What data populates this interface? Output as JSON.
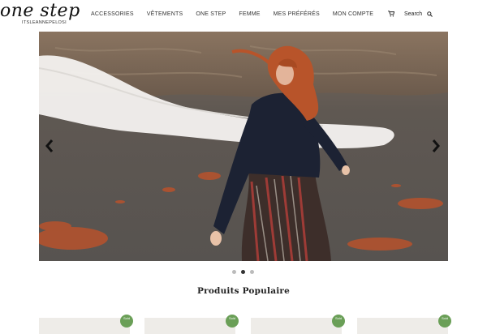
{
  "header": {
    "logo": "one step",
    "logo_sub": "ITSLEANNEPELOSI",
    "nav": [
      "ACCESSORIES",
      "VÊTEMENTS",
      "ONE STEP",
      "FEMME",
      "MES PRÉFÉRÉS",
      "MON COMPTE"
    ],
    "search_label": "Search"
  },
  "slider": {
    "prev_icon": "chevron-left-icon",
    "next_icon": "chevron-right-icon",
    "slide_count": 3,
    "active_slide": 2
  },
  "section": {
    "title": "Produits Populaire"
  },
  "products": [
    {
      "badge": "Sold"
    },
    {
      "badge": "Sold"
    },
    {
      "badge": "Sold"
    },
    {
      "badge": "Sold"
    }
  ],
  "colors": {
    "badge": "#6a9f57",
    "dot_active": "#333333",
    "dot_inactive": "#bbbbbb"
  }
}
